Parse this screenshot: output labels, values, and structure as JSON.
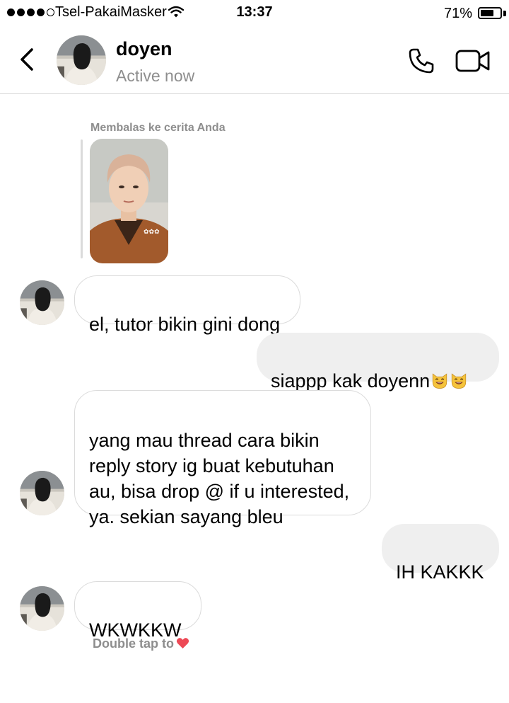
{
  "status_bar": {
    "carrier": "Tsel-PakaiMasker",
    "time": "13:37",
    "battery_percent": "71%",
    "battery_level": 0.71,
    "signal_bars": 4,
    "icons": [
      "signal-dots",
      "wifi-icon",
      "battery-icon"
    ]
  },
  "header": {
    "back_icon": "chevron-left-icon",
    "name": "doyen",
    "status": "Active now",
    "call_icon": "phone-icon",
    "video_icon": "video-camera-icon"
  },
  "story_reply": {
    "label": "Membalas ke cerita Anda"
  },
  "messages": [
    {
      "direction": "incoming",
      "text": "el, tutor bikin gini dong"
    },
    {
      "direction": "outgoing",
      "text": "siappp kak doyenn",
      "emoji": [
        "smiling-cat-emoji",
        "smiling-cat-emoji"
      ]
    },
    {
      "direction": "incoming",
      "text": "yang mau thread cara bikin\nreply story ig buat kebutuhan\nau, bisa drop @ if u interested,\nya. sekian sayang bleu"
    },
    {
      "direction": "outgoing",
      "text": "IH KAKKK"
    },
    {
      "direction": "incoming",
      "text": "WKWKKW"
    }
  ],
  "double_tap_hint": "Double tap to",
  "colors": {
    "secondary_text": "#8e8e8e",
    "incoming_border": "#dbdbdb",
    "outgoing_bg": "#efefef",
    "heart": "#ed4956"
  }
}
